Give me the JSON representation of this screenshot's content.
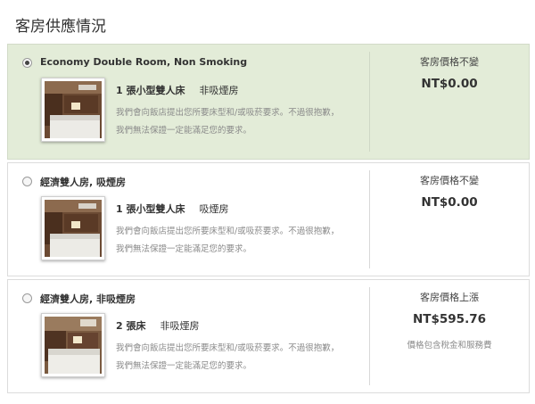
{
  "section_title": "客房供應情況",
  "colors": {
    "selected_bg": "#e3ecd8",
    "border": "#dcdcdc",
    "muted_text": "#8a8a8a"
  },
  "rooms": [
    {
      "name": "Economy Double Room, Non Smoking",
      "selected": true,
      "bed": "1 張小型雙人床",
      "smoking": "非吸煙房",
      "note_line1": "我們會向飯店提出您所要床型和/或吸菸要求。不過很抱歉，",
      "note_line2": "我們無法保證一定能滿足您的要求。",
      "price_status": "客房價格不變",
      "price": "NT$0.00",
      "price_note": ""
    },
    {
      "name": "經濟雙人房, 吸煙房",
      "selected": false,
      "bed": "1 張小型雙人床",
      "smoking": "吸煙房",
      "note_line1": "我們會向飯店提出您所要床型和/或吸菸要求。不過很抱歉，",
      "note_line2": "我們無法保證一定能滿足您的要求。",
      "price_status": "客房價格不變",
      "price": "NT$0.00",
      "price_note": ""
    },
    {
      "name": "經濟雙人房, 非吸煙房",
      "selected": false,
      "bed": "2 張床",
      "smoking": "非吸煙房",
      "note_line1": "我們會向飯店提出您所要床型和/或吸菸要求。不過很抱歉，",
      "note_line2": "我們無法保證一定能滿足您的要求。",
      "price_status": "客房價格上漲",
      "price": "NT$595.76",
      "price_note": "價格包含稅金和服務費"
    }
  ]
}
